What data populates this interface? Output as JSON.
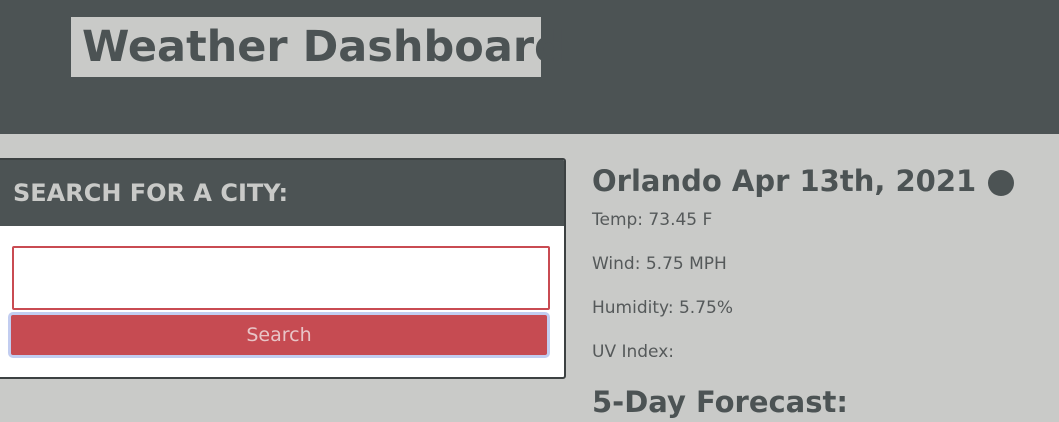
{
  "header": {
    "title": "Weather Dashboard"
  },
  "search": {
    "heading": "SEARCH FOR A CITY:",
    "input_value": "",
    "placeholder": "",
    "button_label": "Search"
  },
  "current": {
    "city": "Orlando",
    "date": "Apr 13th, 2021",
    "city_date": "Orlando Apr 13th, 2021",
    "icon": "weather-icon",
    "temp": "Temp: 73.45 F",
    "wind": "Wind: 5.75 MPH",
    "humidity": "Humidity: 5.75%",
    "uv_index": "UV Index:"
  },
  "forecast": {
    "title": "5-Day Forecast:"
  },
  "colors": {
    "background": "#c9cac8",
    "header": "#4c5354",
    "accent": "#c64b52"
  }
}
